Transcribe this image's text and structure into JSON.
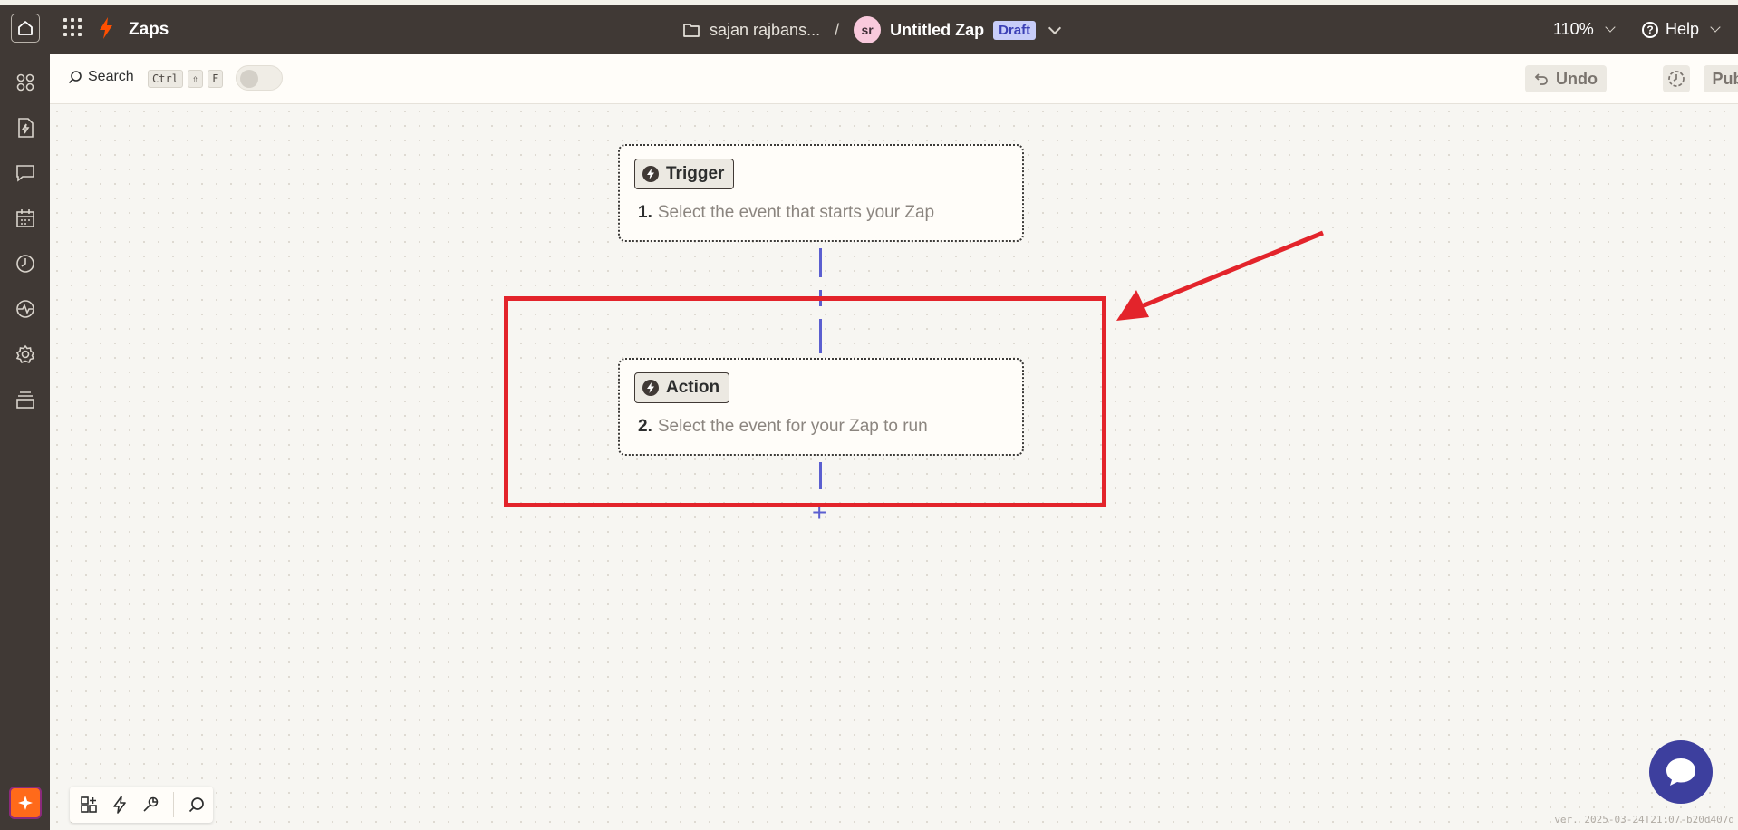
{
  "header": {
    "app_title": "Zaps",
    "folder_name": "sajan rajbans...",
    "separator": "/",
    "avatar_initials": "sr",
    "zap_name": "Untitled Zap",
    "draft_badge": "Draft",
    "zoom_level": "110%",
    "help_label": "Help"
  },
  "toolbar": {
    "search_label": "Search",
    "shortcut_keys": [
      "Ctrl",
      "⇧",
      "F"
    ],
    "undo_label": "Undo",
    "publish_label": "Publish"
  },
  "steps": [
    {
      "pill_label": "Trigger",
      "number": "1.",
      "description": "Select the event that starts your Zap"
    },
    {
      "pill_label": "Action",
      "number": "2.",
      "description": "Select the event for your Zap to run"
    }
  ],
  "version": "ver. 2025-03-24T21:07-b20d407d",
  "colors": {
    "header_bg": "#403935",
    "brand_orange": "#ff4f00",
    "draft_badge_bg": "#c8cdf9",
    "connector": "#5b5fd0",
    "annotation_red": "#e3242b",
    "chat_button": "#3d3f9e"
  },
  "sidebar_icons": [
    "apps-icon",
    "zap-file-icon",
    "chat-icon",
    "calendar-icon",
    "history-icon",
    "activity-icon",
    "settings-icon",
    "layers-icon"
  ]
}
